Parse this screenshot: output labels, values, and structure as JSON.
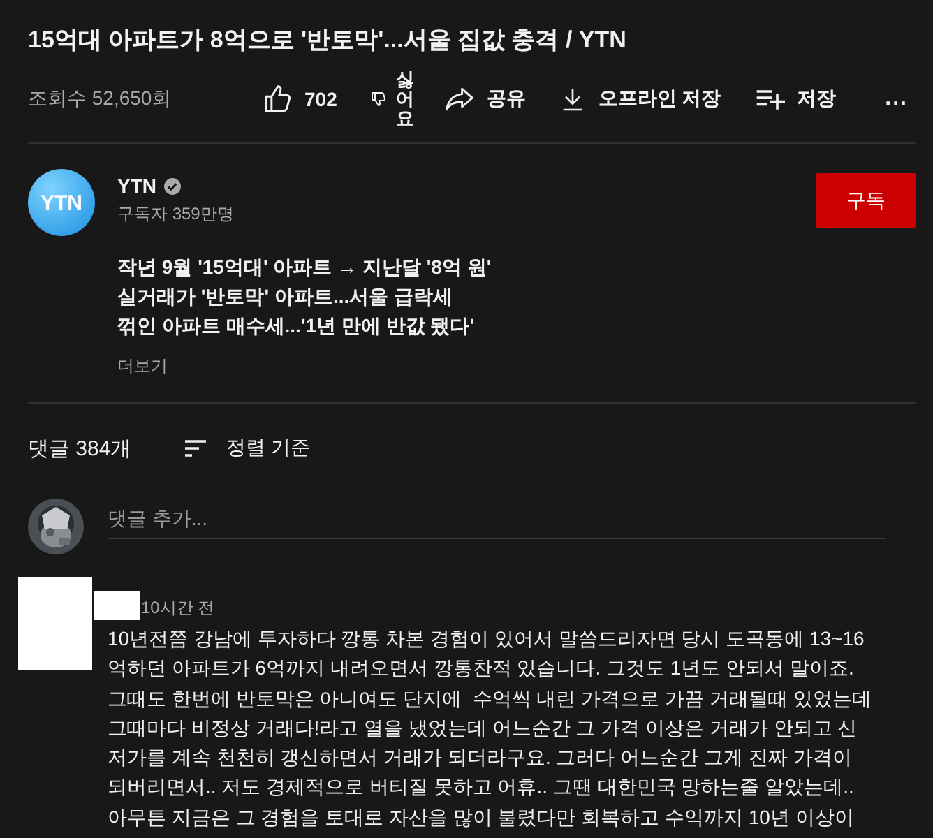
{
  "video": {
    "title": "15억대 아파트가 8억으로 '반토막'...서울 집값 충격 / YTN",
    "views": "조회수 52,650회"
  },
  "actions": [
    {
      "kind": "like",
      "label": "702"
    },
    {
      "kind": "dislike",
      "label": "싫어요"
    },
    {
      "kind": "share",
      "label": "공유"
    },
    {
      "kind": "download",
      "label": "오프라인 저장"
    },
    {
      "kind": "save",
      "label": "저장"
    },
    {
      "kind": "more",
      "label": "..."
    }
  ],
  "channel": {
    "logo": "YTN",
    "name": "YTN",
    "verified": true,
    "subscribers": "구독자 359만명",
    "subscribe": "구독"
  },
  "description": {
    "lines": [
      "작년 9월 '15억대' 아파트 → 지난달 '8억 원'",
      "실거래가 '반토막' 아파트...서울 급락세",
      "꺾인 아파트 매수세...'1년 만에 반값 됐다'"
    ],
    "more": "더보기"
  },
  "comments": {
    "count": "댓글 384개",
    "sort": "정렬 기준",
    "add_placeholder": "댓글 추가...",
    "items": [
      {
        "time": "10시간 전",
        "lines": [
          "10년전쯤 강남에 투자하다 깡통 차본 경험이 있어서 말씀드리자면 당시 도곡동에 13~16",
          "억하던 아파트가 6억까지 내려오면서 깡통찬적 있습니다. 그것도 1년도 안되서 말이죠.",
          "그때도 한번에 반토막은 아니여도 단지에  수억씩 내린 가격으로 가끔 거래될때 있었는데",
          "그때마다 비정상 거래다!라고 열을 냈었는데 어느순간 그 가격 이상은 거래가 안되고 신",
          "저가를 계속 천천히 갱신하면서 거래가 되더라구요. 그러다 어느순간 그게 진짜 가격이",
          "되버리면서.. 저도 경제적으로 버티질 못하고 어휴.. 그땐 대한민국 망하는줄 알았는데..",
          "아무튼 지금은 그 경험을 토대로 자산을 많이 불렸다만 회복하고 수익까지 10년 이상이"
        ]
      }
    ]
  }
}
